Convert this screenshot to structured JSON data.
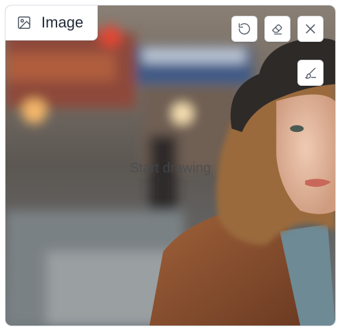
{
  "panel": {
    "label": "Image",
    "hint": "Start drawing"
  },
  "toolbar": {
    "buttons": [
      "undo-icon",
      "eraser-icon",
      "close-icon",
      "brush-icon"
    ]
  },
  "colors": {
    "icon": "#4b5563",
    "label_text": "#1f2937",
    "border": "#d7dbe0"
  }
}
